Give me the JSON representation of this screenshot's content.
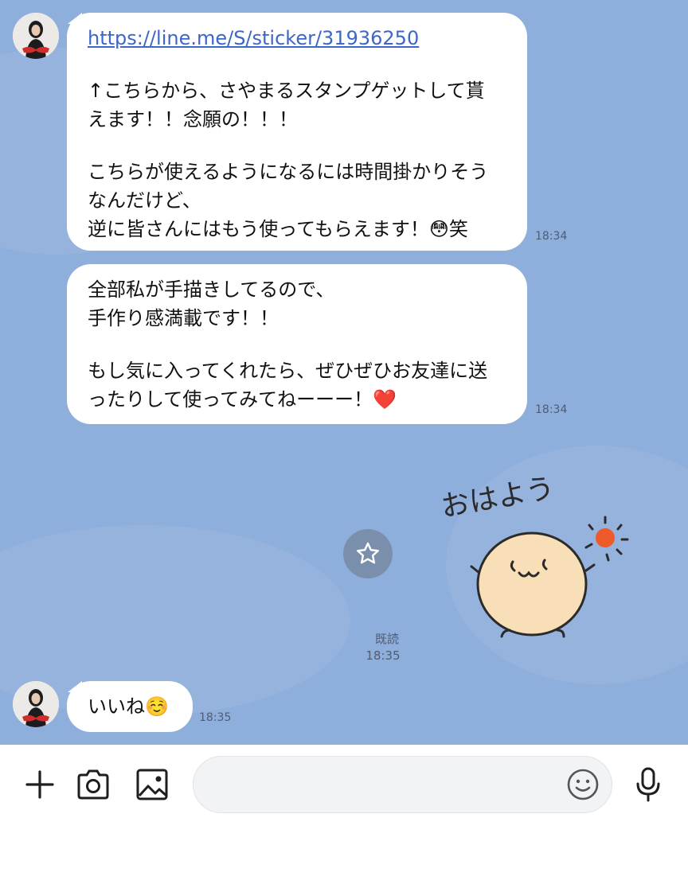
{
  "messages": [
    {
      "lines": [
        "↑こちらから、さやまるスタンプゲットして貰",
        "えます！！念願の！！！",
        "",
        "こちらが使えるようになるには時間掛かりそう",
        "なんだけど、",
        "逆に皆さんにはもう使ってもらえます！😳笑"
      ],
      "link": "https://line.me/S/sticker/31936250",
      "time": "18:34"
    },
    {
      "lines": [
        "全部私が手描きしてるので、",
        "手作り感満載です！！",
        "",
        "もし気に入ってくれたら、ぜひぜひお友達に送",
        "ったりして使ってみてねーーー！❤️"
      ],
      "time": "18:34"
    },
    {
      "lines": [
        "いいね☺️"
      ],
      "time": "18:35"
    }
  ],
  "sticker": {
    "text": "おはよう",
    "read_label": "既読",
    "time": "18:35",
    "sun_color": "#ee5a2a",
    "face_color": "#f8dfb8"
  },
  "composer": {
    "placeholder": "",
    "icons": [
      "plus-icon",
      "camera-icon",
      "image-icon",
      "emoji-icon",
      "microphone-icon"
    ]
  },
  "colors": {
    "chat_background": "#8eaedb",
    "bubble": "#ffffff",
    "link": "#3d66c9"
  }
}
